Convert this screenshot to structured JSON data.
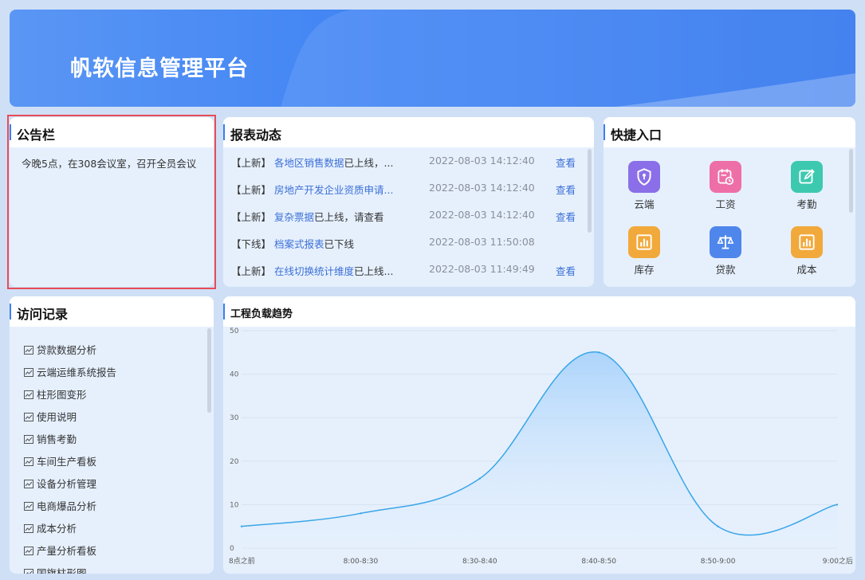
{
  "banner": {
    "title": "帆软信息管理平台"
  },
  "notice": {
    "title": "公告栏",
    "text": "今晚5点，在308会议室，召开全员会议"
  },
  "reports": {
    "title": "报表动态",
    "rows": [
      {
        "tag": "【上新】",
        "name": "各地区销售数据",
        "rest": "已上线，...",
        "time": "2022-08-03 14:12:40",
        "action": "查看"
      },
      {
        "tag": "【上新】",
        "name": "房地产开发企业资质申请...",
        "rest": "",
        "time": "2022-08-03 14:12:40",
        "action": "查看"
      },
      {
        "tag": "【上新】",
        "name": "复杂票据",
        "rest": "已上线，请查看",
        "time": "2022-08-03 14:12:40",
        "action": "查看"
      },
      {
        "tag": "【下线】",
        "name": "档案式报表",
        "rest": "已下线",
        "time": "2022-08-03 11:50:08",
        "action": ""
      },
      {
        "tag": "【上新】",
        "name": "在线切换统计维度",
        "rest": "已上线...",
        "time": "2022-08-03 11:49:49",
        "action": "查看"
      }
    ]
  },
  "quick": {
    "title": "快捷入口",
    "items": [
      {
        "label": "云端",
        "icon": "shield-icon",
        "color": "#8a6fe8"
      },
      {
        "label": "工资",
        "icon": "calendar-clock-icon",
        "color": "#ee6fa8"
      },
      {
        "label": "考勤",
        "icon": "edit-icon",
        "color": "#3dc9b0"
      },
      {
        "label": "库存",
        "icon": "bar-chart-icon",
        "color": "#f2a93b"
      },
      {
        "label": "贷款",
        "icon": "scale-icon",
        "color": "#4f86ec"
      },
      {
        "label": "成本",
        "icon": "bar-chart-icon",
        "color": "#f2a93b"
      }
    ]
  },
  "visits": {
    "title": "访问记录",
    "items": [
      "贷款数据分析",
      "云端运维系统报告",
      "柱形图变形",
      "使用说明",
      "销售考勤",
      "车间生产看板",
      "设备分析管理",
      "电商爆品分析",
      "成本分析",
      "产量分析看板",
      "国旗柱形图"
    ]
  },
  "chart_data": {
    "type": "area",
    "title": "工程负载趋势",
    "x": [
      "8点之前",
      "8:00-8:30",
      "8:30-8:40",
      "8:40-8:50",
      "8:50-9:00",
      "9:00之后"
    ],
    "values": [
      5,
      8,
      16,
      45,
      5,
      10
    ],
    "ylim": [
      0,
      50
    ],
    "yticks": [
      0,
      10,
      20,
      30,
      40,
      50
    ],
    "grid": true,
    "color": "#3aa6e8"
  }
}
